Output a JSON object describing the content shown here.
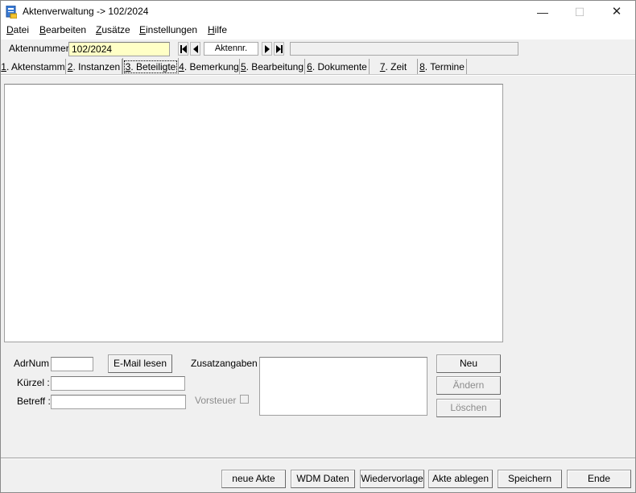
{
  "window": {
    "title": "Aktenverwaltung -> 102/2024",
    "controls": {
      "minimize": "—",
      "maximize": "☐",
      "close": "✕"
    }
  },
  "menu": {
    "items": [
      {
        "key": "D",
        "rest": "atei"
      },
      {
        "key": "B",
        "rest": "earbeiten"
      },
      {
        "key": "Z",
        "rest": "usätze"
      },
      {
        "key": "E",
        "rest": "instellungen"
      },
      {
        "key": "H",
        "rest": "ilfe"
      }
    ]
  },
  "toolbar": {
    "aktennummer_label": "Aktennummer :",
    "aktennummer_value": "102/2024",
    "nav_field": "Aktennr.",
    "icons": [
      "first-record-icon",
      "prev-record-icon",
      "next-record-icon",
      "last-record-icon"
    ]
  },
  "tabs": [
    {
      "key": "1",
      "rest": ". Aktenstamm"
    },
    {
      "key": "2",
      "rest": ". Instanzen"
    },
    {
      "key": "3",
      "rest": ". Beteiligte",
      "active": true
    },
    {
      "key": "4",
      "rest": ". Bemerkung"
    },
    {
      "key": "5",
      "rest": ". Bearbeitung"
    },
    {
      "key": "6",
      "rest": ". Dokumente"
    },
    {
      "key": "7",
      "rest": ". Zeit"
    },
    {
      "key": "8",
      "rest": ". Termine"
    }
  ],
  "form": {
    "adrnum_label": "AdrNum :",
    "adrnum_value": "",
    "email_button": "E-Mail lesen",
    "kuerzel_label": "Kürzel :",
    "kuerzel_value": "",
    "betreff_label": "Betreff :",
    "betreff_value": "",
    "zusatz_label": "Zusatzangaben :",
    "vorsteuer_label": "Vorsteuer",
    "vorsteuer_checked": false,
    "neu_button": "Neu",
    "aendern_button": "Ändern",
    "loeschen_button": "Löschen"
  },
  "footer": {
    "buttons": [
      "neue Akte",
      "WDM Daten",
      "Wiedervorlage",
      "Akte ablegen",
      "Speichern",
      "Ende"
    ]
  },
  "colors": {
    "accent_field": "#ffffc6",
    "window_bg": "#f0f0f0"
  }
}
